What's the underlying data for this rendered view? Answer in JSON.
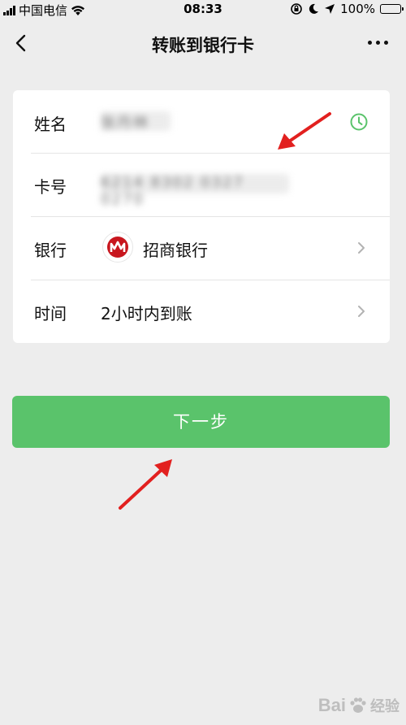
{
  "status_bar": {
    "carrier": "中国电信",
    "time": "08:33",
    "battery": "100%"
  },
  "nav": {
    "title": "转账到银行卡",
    "back_icon": "chevron-left-icon",
    "more_icon": "more-dots-icon"
  },
  "form": {
    "name": {
      "label": "姓名",
      "value": "张丹林"
    },
    "card": {
      "label": "卡号",
      "value": "6214 8302 0327 0270"
    },
    "bank": {
      "label": "银行",
      "value": "招商银行",
      "logo_letter": "M",
      "logo_color": "#c8161e"
    },
    "time": {
      "label": "时间",
      "value": "2小时内到账"
    }
  },
  "next_button": {
    "label": "下一步",
    "color": "#5ac36b"
  },
  "colors": {
    "accent": "#5ac36b",
    "annotation": "#e2201f",
    "background": "#ededed"
  },
  "watermark": {
    "brand": "Bai",
    "suffix": "经验"
  }
}
